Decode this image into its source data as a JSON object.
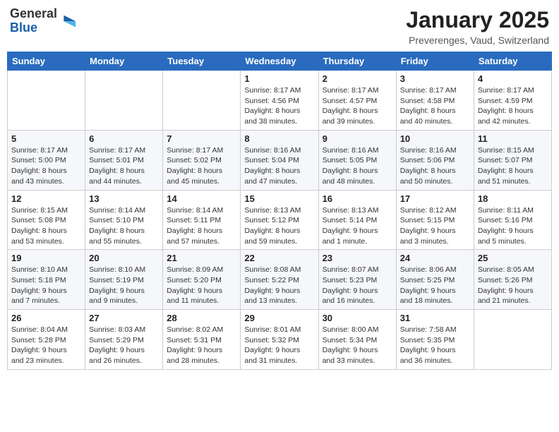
{
  "logo": {
    "general": "General",
    "blue": "Blue"
  },
  "header": {
    "month": "January 2025",
    "location": "Preverenges, Vaud, Switzerland"
  },
  "weekdays": [
    "Sunday",
    "Monday",
    "Tuesday",
    "Wednesday",
    "Thursday",
    "Friday",
    "Saturday"
  ],
  "weeks": [
    [
      {
        "day": "",
        "sunrise": "",
        "sunset": "",
        "daylight": ""
      },
      {
        "day": "",
        "sunrise": "",
        "sunset": "",
        "daylight": ""
      },
      {
        "day": "",
        "sunrise": "",
        "sunset": "",
        "daylight": ""
      },
      {
        "day": "1",
        "sunrise": "Sunrise: 8:17 AM",
        "sunset": "Sunset: 4:56 PM",
        "daylight": "Daylight: 8 hours and 38 minutes."
      },
      {
        "day": "2",
        "sunrise": "Sunrise: 8:17 AM",
        "sunset": "Sunset: 4:57 PM",
        "daylight": "Daylight: 8 hours and 39 minutes."
      },
      {
        "day": "3",
        "sunrise": "Sunrise: 8:17 AM",
        "sunset": "Sunset: 4:58 PM",
        "daylight": "Daylight: 8 hours and 40 minutes."
      },
      {
        "day": "4",
        "sunrise": "Sunrise: 8:17 AM",
        "sunset": "Sunset: 4:59 PM",
        "daylight": "Daylight: 8 hours and 42 minutes."
      }
    ],
    [
      {
        "day": "5",
        "sunrise": "Sunrise: 8:17 AM",
        "sunset": "Sunset: 5:00 PM",
        "daylight": "Daylight: 8 hours and 43 minutes."
      },
      {
        "day": "6",
        "sunrise": "Sunrise: 8:17 AM",
        "sunset": "Sunset: 5:01 PM",
        "daylight": "Daylight: 8 hours and 44 minutes."
      },
      {
        "day": "7",
        "sunrise": "Sunrise: 8:17 AM",
        "sunset": "Sunset: 5:02 PM",
        "daylight": "Daylight: 8 hours and 45 minutes."
      },
      {
        "day": "8",
        "sunrise": "Sunrise: 8:16 AM",
        "sunset": "Sunset: 5:04 PM",
        "daylight": "Daylight: 8 hours and 47 minutes."
      },
      {
        "day": "9",
        "sunrise": "Sunrise: 8:16 AM",
        "sunset": "Sunset: 5:05 PM",
        "daylight": "Daylight: 8 hours and 48 minutes."
      },
      {
        "day": "10",
        "sunrise": "Sunrise: 8:16 AM",
        "sunset": "Sunset: 5:06 PM",
        "daylight": "Daylight: 8 hours and 50 minutes."
      },
      {
        "day": "11",
        "sunrise": "Sunrise: 8:15 AM",
        "sunset": "Sunset: 5:07 PM",
        "daylight": "Daylight: 8 hours and 51 minutes."
      }
    ],
    [
      {
        "day": "12",
        "sunrise": "Sunrise: 8:15 AM",
        "sunset": "Sunset: 5:08 PM",
        "daylight": "Daylight: 8 hours and 53 minutes."
      },
      {
        "day": "13",
        "sunrise": "Sunrise: 8:14 AM",
        "sunset": "Sunset: 5:10 PM",
        "daylight": "Daylight: 8 hours and 55 minutes."
      },
      {
        "day": "14",
        "sunrise": "Sunrise: 8:14 AM",
        "sunset": "Sunset: 5:11 PM",
        "daylight": "Daylight: 8 hours and 57 minutes."
      },
      {
        "day": "15",
        "sunrise": "Sunrise: 8:13 AM",
        "sunset": "Sunset: 5:12 PM",
        "daylight": "Daylight: 8 hours and 59 minutes."
      },
      {
        "day": "16",
        "sunrise": "Sunrise: 8:13 AM",
        "sunset": "Sunset: 5:14 PM",
        "daylight": "Daylight: 9 hours and 1 minute."
      },
      {
        "day": "17",
        "sunrise": "Sunrise: 8:12 AM",
        "sunset": "Sunset: 5:15 PM",
        "daylight": "Daylight: 9 hours and 3 minutes."
      },
      {
        "day": "18",
        "sunrise": "Sunrise: 8:11 AM",
        "sunset": "Sunset: 5:16 PM",
        "daylight": "Daylight: 9 hours and 5 minutes."
      }
    ],
    [
      {
        "day": "19",
        "sunrise": "Sunrise: 8:10 AM",
        "sunset": "Sunset: 5:18 PM",
        "daylight": "Daylight: 9 hours and 7 minutes."
      },
      {
        "day": "20",
        "sunrise": "Sunrise: 8:10 AM",
        "sunset": "Sunset: 5:19 PM",
        "daylight": "Daylight: 9 hours and 9 minutes."
      },
      {
        "day": "21",
        "sunrise": "Sunrise: 8:09 AM",
        "sunset": "Sunset: 5:20 PM",
        "daylight": "Daylight: 9 hours and 11 minutes."
      },
      {
        "day": "22",
        "sunrise": "Sunrise: 8:08 AM",
        "sunset": "Sunset: 5:22 PM",
        "daylight": "Daylight: 9 hours and 13 minutes."
      },
      {
        "day": "23",
        "sunrise": "Sunrise: 8:07 AM",
        "sunset": "Sunset: 5:23 PM",
        "daylight": "Daylight: 9 hours and 16 minutes."
      },
      {
        "day": "24",
        "sunrise": "Sunrise: 8:06 AM",
        "sunset": "Sunset: 5:25 PM",
        "daylight": "Daylight: 9 hours and 18 minutes."
      },
      {
        "day": "25",
        "sunrise": "Sunrise: 8:05 AM",
        "sunset": "Sunset: 5:26 PM",
        "daylight": "Daylight: 9 hours and 21 minutes."
      }
    ],
    [
      {
        "day": "26",
        "sunrise": "Sunrise: 8:04 AM",
        "sunset": "Sunset: 5:28 PM",
        "daylight": "Daylight: 9 hours and 23 minutes."
      },
      {
        "day": "27",
        "sunrise": "Sunrise: 8:03 AM",
        "sunset": "Sunset: 5:29 PM",
        "daylight": "Daylight: 9 hours and 26 minutes."
      },
      {
        "day": "28",
        "sunrise": "Sunrise: 8:02 AM",
        "sunset": "Sunset: 5:31 PM",
        "daylight": "Daylight: 9 hours and 28 minutes."
      },
      {
        "day": "29",
        "sunrise": "Sunrise: 8:01 AM",
        "sunset": "Sunset: 5:32 PM",
        "daylight": "Daylight: 9 hours and 31 minutes."
      },
      {
        "day": "30",
        "sunrise": "Sunrise: 8:00 AM",
        "sunset": "Sunset: 5:34 PM",
        "daylight": "Daylight: 9 hours and 33 minutes."
      },
      {
        "day": "31",
        "sunrise": "Sunrise: 7:58 AM",
        "sunset": "Sunset: 5:35 PM",
        "daylight": "Daylight: 9 hours and 36 minutes."
      },
      {
        "day": "",
        "sunrise": "",
        "sunset": "",
        "daylight": ""
      }
    ]
  ]
}
